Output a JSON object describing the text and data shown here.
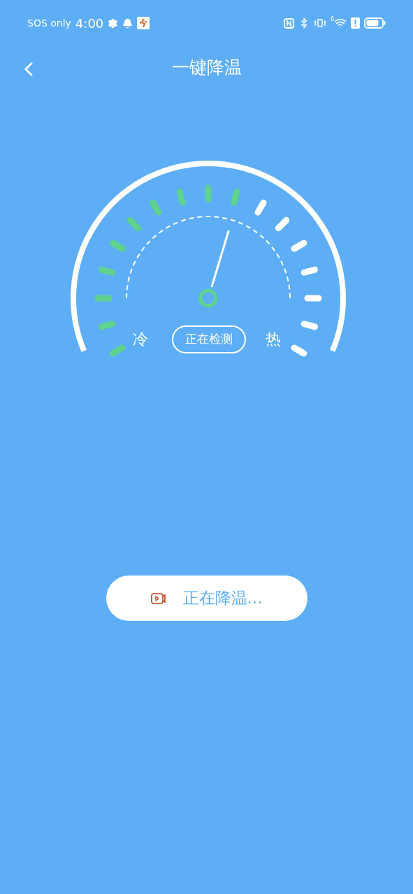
{
  "status_bar": {
    "carrier": "SOS only",
    "time": "4:00",
    "wifi_superscript": "6"
  },
  "header": {
    "title": "一键降温"
  },
  "gauge": {
    "cold_label": "冷",
    "hot_label": "热",
    "status": "正在检测"
  },
  "action_button": {
    "label": "正在降温..."
  }
}
